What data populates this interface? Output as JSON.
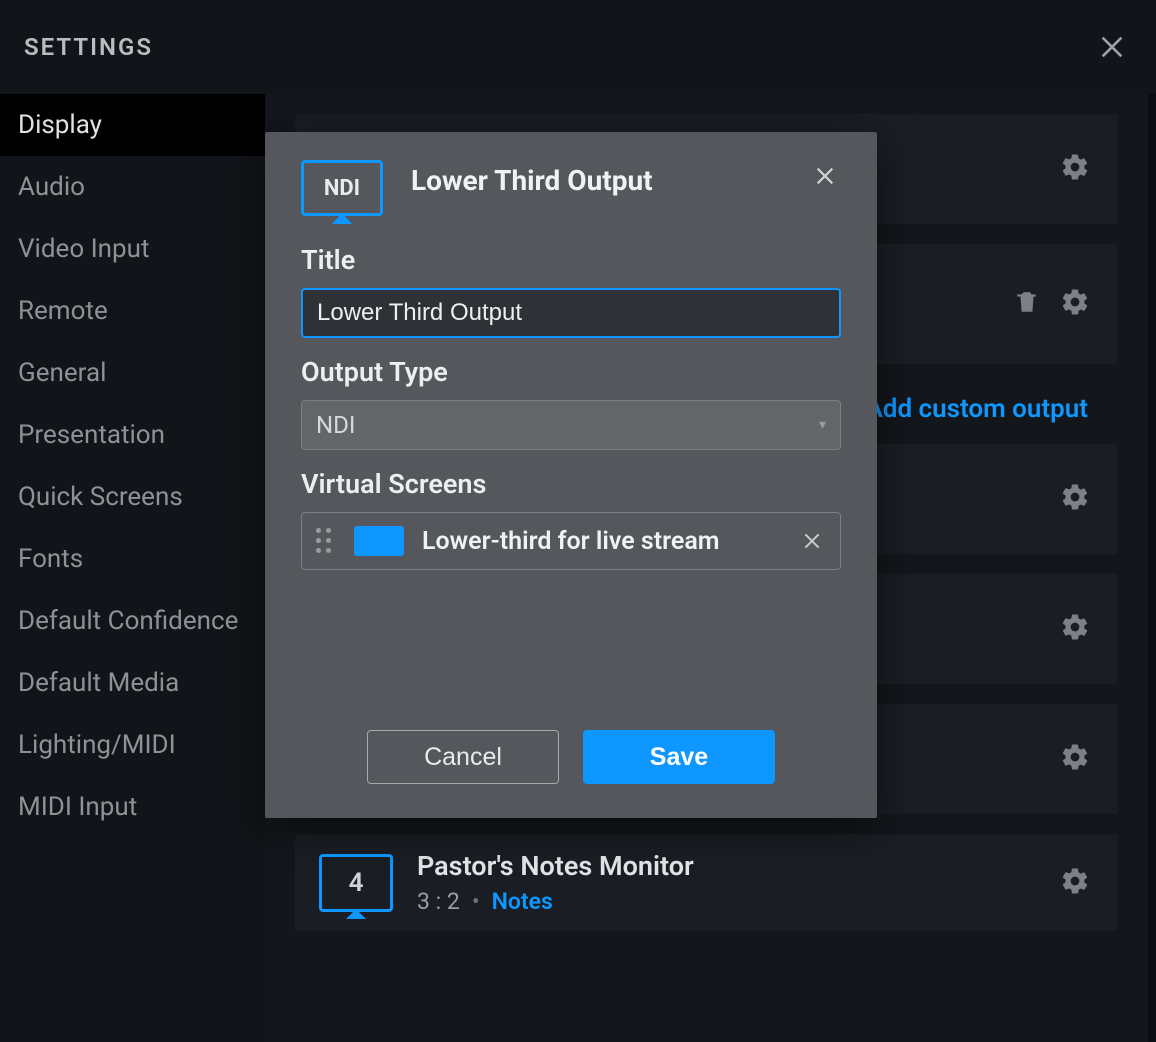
{
  "header": {
    "title": "SETTINGS"
  },
  "sidebar": {
    "items": [
      {
        "label": "Display",
        "active": true
      },
      {
        "label": "Audio"
      },
      {
        "label": "Video Input"
      },
      {
        "label": "Remote"
      },
      {
        "label": "General"
      },
      {
        "label": "Presentation"
      },
      {
        "label": "Quick Screens"
      },
      {
        "label": "Fonts"
      },
      {
        "label": "Default Confidence"
      },
      {
        "label": "Default Media"
      },
      {
        "label": "Lighting/MIDI"
      },
      {
        "label": "MIDI Input"
      }
    ]
  },
  "background": {
    "add_link": "Add custom output",
    "exposed_row": {
      "thumb_number": "4",
      "title": "Pastor's Notes Monitor",
      "ratio": "3 : 2",
      "tag": "Notes"
    }
  },
  "modal": {
    "ndi_label": "NDI",
    "title": "Lower Third Output",
    "fields": {
      "title_label": "Title",
      "title_value": "Lower Third Output",
      "output_type_label": "Output Type",
      "output_type_value": "NDI",
      "virtual_screens_label": "Virtual Screens",
      "virtual_screen_item": "Lower-third for live stream"
    },
    "actions": {
      "cancel": "Cancel",
      "save": "Save"
    }
  }
}
